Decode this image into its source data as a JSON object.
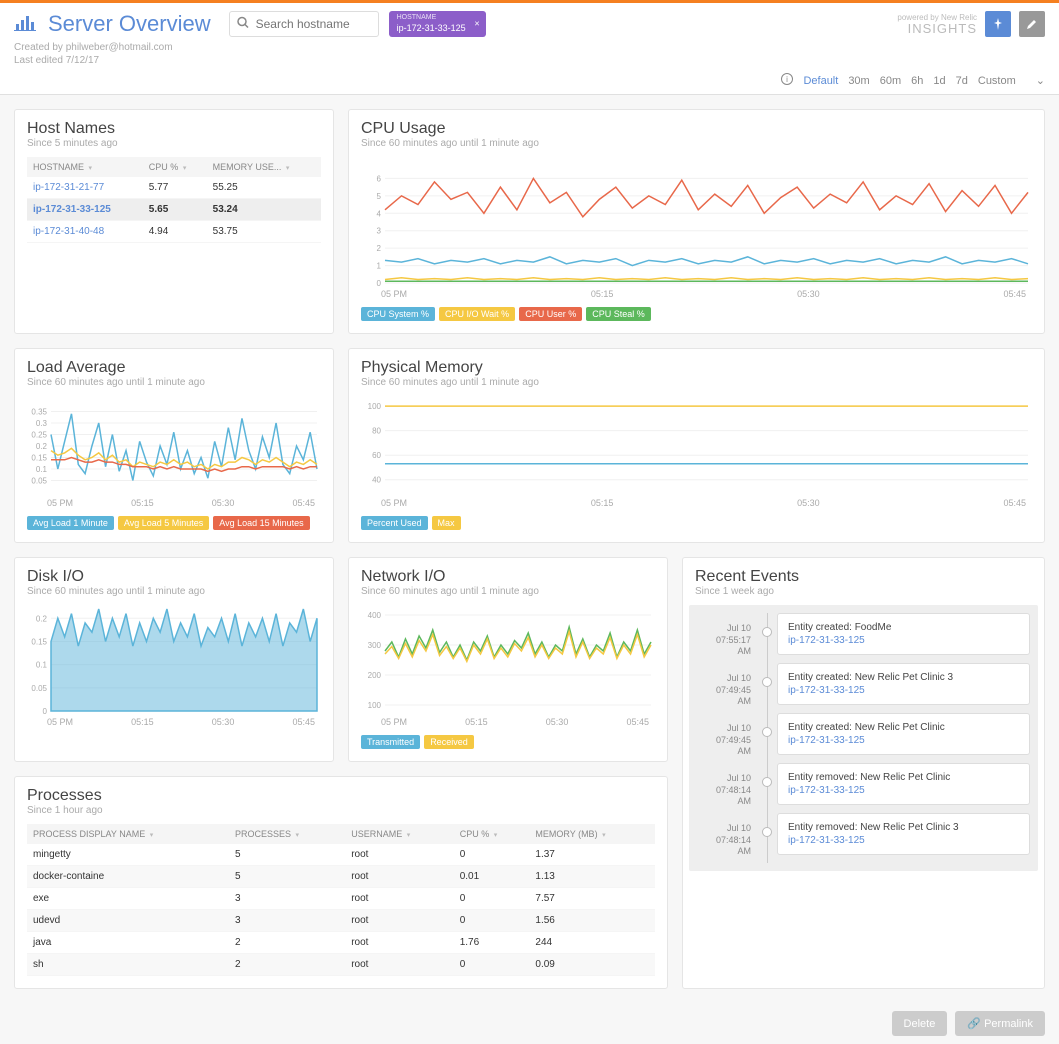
{
  "header": {
    "title": "Server Overview",
    "search_placeholder": "Search hostname",
    "active_filter_label": "HOSTNAME",
    "active_filter_value": "ip-172-31-33-125",
    "created_by": "Created by philweber@hotmail.com",
    "last_edited": "Last edited 7/12/17",
    "brand_small": "New Relic",
    "brand_big": "INSIGHTS",
    "powered": "powered by"
  },
  "time_picker": {
    "options": [
      "Default",
      "30m",
      "60m",
      "6h",
      "1d",
      "7d",
      "Custom"
    ],
    "active": "Default"
  },
  "hosts": {
    "title": "Host Names",
    "sub": "Since 5 minutes ago",
    "columns": [
      "HOSTNAME",
      "CPU %",
      "MEMORY USE..."
    ],
    "rows": [
      {
        "host": "ip-172-31-21-77",
        "cpu": "5.77",
        "mem": "55.25",
        "selected": false
      },
      {
        "host": "ip-172-31-33-125",
        "cpu": "5.65",
        "mem": "53.24",
        "selected": true
      },
      {
        "host": "ip-172-31-40-48",
        "cpu": "4.94",
        "mem": "53.75",
        "selected": false
      }
    ]
  },
  "cpu": {
    "title": "CPU Usage",
    "sub": "Since 60 minutes ago until 1 minute ago",
    "legend": [
      {
        "label": "CPU System %",
        "color": "#5bb4d9"
      },
      {
        "label": "CPU I/O Wait %",
        "color": "#f5c842"
      },
      {
        "label": "CPU User %",
        "color": "#e8684a"
      },
      {
        "label": "CPU Steal %",
        "color": "#5cb85c"
      }
    ]
  },
  "load": {
    "title": "Load Average",
    "sub": "Since 60 minutes ago until 1 minute ago",
    "legend": [
      {
        "label": "Avg Load 1 Minute",
        "color": "#5bb4d9"
      },
      {
        "label": "Avg Load 5 Minutes",
        "color": "#f5c842"
      },
      {
        "label": "Avg Load 15 Minutes",
        "color": "#e8684a"
      }
    ]
  },
  "memory": {
    "title": "Physical Memory",
    "sub": "Since 60 minutes ago until 1 minute ago",
    "legend": [
      {
        "label": "Percent Used",
        "color": "#5bb4d9"
      },
      {
        "label": "Max",
        "color": "#f5c842"
      }
    ]
  },
  "disk": {
    "title": "Disk I/O",
    "sub": "Since 60 minutes ago until 1 minute ago"
  },
  "network": {
    "title": "Network I/O",
    "sub": "Since 60 minutes ago until 1 minute ago",
    "legend": [
      {
        "label": "Transmitted",
        "color": "#5bb4d9"
      },
      {
        "label": "Received",
        "color": "#f5c842"
      }
    ]
  },
  "events": {
    "title": "Recent Events",
    "sub": "Since 1 week ago",
    "items": [
      {
        "date": "Jul 10",
        "time": "07:55:17",
        "ampm": "AM",
        "title": "Entity created: FoodMe",
        "host": "ip-172-31-33-125"
      },
      {
        "date": "Jul 10",
        "time": "07:49:45",
        "ampm": "AM",
        "title": "Entity created: New Relic Pet Clinic 3",
        "host": "ip-172-31-33-125"
      },
      {
        "date": "Jul 10",
        "time": "07:49:45",
        "ampm": "AM",
        "title": "Entity created: New Relic Pet Clinic",
        "host": "ip-172-31-33-125"
      },
      {
        "date": "Jul 10",
        "time": "07:48:14",
        "ampm": "AM",
        "title": "Entity removed: New Relic Pet Clinic",
        "host": "ip-172-31-33-125"
      },
      {
        "date": "Jul 10",
        "time": "07:48:14",
        "ampm": "AM",
        "title": "Entity removed: New Relic Pet Clinic 3",
        "host": "ip-172-31-33-125"
      }
    ]
  },
  "processes": {
    "title": "Processes",
    "sub": "Since 1 hour ago",
    "columns": [
      "PROCESS DISPLAY NAME",
      "PROCESSES",
      "USERNAME",
      "CPU %",
      "MEMORY (MB)"
    ],
    "rows": [
      {
        "name": "mingetty",
        "count": "5",
        "user": "root",
        "cpu": "0",
        "mem": "1.37"
      },
      {
        "name": "docker-containe",
        "count": "5",
        "user": "root",
        "cpu": "0.01",
        "mem": "1.13"
      },
      {
        "name": "exe",
        "count": "3",
        "user": "root",
        "cpu": "0",
        "mem": "7.57"
      },
      {
        "name": "udevd",
        "count": "3",
        "user": "root",
        "cpu": "0",
        "mem": "1.56"
      },
      {
        "name": "java",
        "count": "2",
        "user": "root",
        "cpu": "1.76",
        "mem": "244"
      },
      {
        "name": "sh",
        "count": "2",
        "user": "root",
        "cpu": "0",
        "mem": "0.09"
      }
    ]
  },
  "footer": {
    "delete": "Delete",
    "permalink": "Permalink"
  },
  "chart_data": [
    {
      "id": "cpu",
      "type": "line",
      "title": "CPU Usage",
      "x_ticks": [
        "05 PM",
        "05:15",
        "05:30",
        "05:45"
      ],
      "y_ticks": [
        0,
        1,
        2,
        3,
        4,
        5,
        6
      ],
      "ylim": [
        0,
        7
      ],
      "series": [
        {
          "name": "CPU User %",
          "color": "#e8684a",
          "values": [
            4.2,
            5.0,
            4.5,
            5.8,
            4.8,
            5.2,
            4.0,
            5.5,
            4.2,
            6.0,
            4.6,
            5.2,
            3.8,
            4.8,
            5.5,
            4.3,
            5.0,
            4.5,
            5.9,
            4.2,
            5.1,
            4.4,
            5.6,
            4.0,
            4.9,
            5.5,
            4.3,
            5.1,
            4.6,
            5.8,
            4.2,
            5.0,
            4.5,
            5.7,
            4.1,
            5.3,
            4.4,
            5.6,
            4.0,
            5.2
          ]
        },
        {
          "name": "CPU System %",
          "color": "#5bb4d9",
          "values": [
            1.3,
            1.2,
            1.4,
            1.1,
            1.3,
            1.2,
            1.4,
            1.1,
            1.3,
            1.2,
            1.5,
            1.1,
            1.3,
            1.2,
            1.4,
            1.0,
            1.3,
            1.2,
            1.4,
            1.1,
            1.3,
            1.2,
            1.5,
            1.1,
            1.3,
            1.2,
            1.4,
            1.1,
            1.3,
            1.2,
            1.4,
            1.1,
            1.3,
            1.2,
            1.5,
            1.1,
            1.3,
            1.2,
            1.4,
            1.1
          ]
        },
        {
          "name": "CPU I/O Wait %",
          "color": "#f5c842",
          "values": [
            0.2,
            0.3,
            0.2,
            0.25,
            0.2,
            0.3,
            0.2,
            0.25,
            0.2,
            0.3,
            0.2,
            0.25,
            0.2,
            0.3,
            0.2,
            0.25,
            0.2,
            0.3,
            0.2,
            0.25,
            0.2,
            0.3,
            0.2,
            0.25,
            0.2,
            0.3,
            0.2,
            0.25,
            0.2,
            0.3,
            0.2,
            0.25,
            0.2,
            0.3,
            0.2,
            0.25,
            0.2,
            0.3,
            0.2,
            0.25
          ]
        },
        {
          "name": "CPU Steal %",
          "color": "#5cb85c",
          "values": [
            0.1,
            0.1,
            0.1,
            0.1,
            0.1,
            0.1,
            0.1,
            0.1,
            0.1,
            0.1,
            0.1,
            0.1,
            0.1,
            0.1,
            0.1,
            0.1,
            0.1,
            0.1,
            0.1,
            0.1,
            0.1,
            0.1,
            0.1,
            0.1,
            0.1,
            0.1,
            0.1,
            0.1,
            0.1,
            0.1,
            0.1,
            0.1,
            0.1,
            0.1,
            0.1,
            0.1,
            0.1,
            0.1,
            0.1,
            0.1
          ]
        }
      ]
    },
    {
      "id": "load",
      "type": "line",
      "title": "Load Average",
      "x_ticks": [
        "05 PM",
        "05:15",
        "05:30",
        "05:45"
      ],
      "y_ticks": [
        0.05,
        0.1,
        0.15,
        0.2,
        0.25,
        0.3,
        0.35
      ],
      "ylim": [
        0,
        0.4
      ],
      "series": [
        {
          "name": "Avg Load 1 Minute",
          "color": "#5bb4d9",
          "values": [
            0.25,
            0.1,
            0.22,
            0.34,
            0.12,
            0.08,
            0.2,
            0.3,
            0.11,
            0.25,
            0.09,
            0.18,
            0.05,
            0.22,
            0.13,
            0.07,
            0.2,
            0.12,
            0.26,
            0.1,
            0.18,
            0.08,
            0.15,
            0.06,
            0.22,
            0.11,
            0.28,
            0.14,
            0.32,
            0.18,
            0.1,
            0.24,
            0.15,
            0.3,
            0.12,
            0.08,
            0.2,
            0.14,
            0.26,
            0.1
          ]
        },
        {
          "name": "Avg Load 5 Minutes",
          "color": "#f5c842",
          "values": [
            0.18,
            0.16,
            0.17,
            0.19,
            0.16,
            0.14,
            0.15,
            0.17,
            0.14,
            0.16,
            0.13,
            0.14,
            0.11,
            0.13,
            0.12,
            0.11,
            0.13,
            0.12,
            0.14,
            0.12,
            0.13,
            0.11,
            0.12,
            0.1,
            0.12,
            0.11,
            0.13,
            0.13,
            0.15,
            0.14,
            0.12,
            0.14,
            0.13,
            0.15,
            0.13,
            0.11,
            0.13,
            0.12,
            0.14,
            0.12
          ]
        },
        {
          "name": "Avg Load 15 Minutes",
          "color": "#e8684a",
          "values": [
            0.14,
            0.14,
            0.14,
            0.15,
            0.14,
            0.13,
            0.13,
            0.14,
            0.13,
            0.13,
            0.12,
            0.12,
            0.11,
            0.11,
            0.11,
            0.1,
            0.11,
            0.1,
            0.11,
            0.1,
            0.1,
            0.1,
            0.1,
            0.09,
            0.1,
            0.09,
            0.1,
            0.1,
            0.11,
            0.11,
            0.1,
            0.11,
            0.11,
            0.11,
            0.11,
            0.1,
            0.11,
            0.1,
            0.11,
            0.11
          ]
        }
      ]
    },
    {
      "id": "memory",
      "type": "line",
      "title": "Physical Memory",
      "x_ticks": [
        "05 PM",
        "05:15",
        "05:30",
        "05:45"
      ],
      "y_ticks": [
        40,
        60,
        80,
        100
      ],
      "ylim": [
        30,
        105
      ],
      "series": [
        {
          "name": "Max",
          "color": "#f5c842",
          "values": [
            100,
            100,
            100,
            100,
            100,
            100,
            100,
            100,
            100,
            100,
            100,
            100,
            100,
            100,
            100,
            100,
            100,
            100,
            100,
            100,
            100,
            100,
            100,
            100,
            100,
            100,
            100,
            100,
            100,
            100,
            100,
            100,
            100,
            100,
            100,
            100,
            100,
            100,
            100,
            100
          ]
        },
        {
          "name": "Percent Used",
          "color": "#5bb4d9",
          "values": [
            53,
            53,
            53,
            53,
            53,
            53,
            53,
            53,
            53,
            53,
            53,
            53,
            53,
            53,
            53,
            53,
            53,
            53,
            53,
            53,
            53,
            53,
            53,
            53,
            53,
            53,
            53,
            53,
            53,
            53,
            53,
            53,
            53,
            53,
            53,
            53,
            53,
            53,
            53,
            53
          ]
        }
      ]
    },
    {
      "id": "disk",
      "type": "area",
      "title": "Disk I/O",
      "x_ticks": [
        "05 PM",
        "05:15",
        "05:30",
        "05:45"
      ],
      "y_ticks": [
        0,
        0.05,
        0.1,
        0.15,
        0.2
      ],
      "ylim": [
        0,
        0.22
      ],
      "series": [
        {
          "name": "Disk I/O",
          "color": "#5bb4d9",
          "values": [
            0.15,
            0.2,
            0.16,
            0.21,
            0.14,
            0.19,
            0.17,
            0.22,
            0.15,
            0.2,
            0.16,
            0.21,
            0.14,
            0.19,
            0.15,
            0.2,
            0.17,
            0.22,
            0.15,
            0.19,
            0.16,
            0.21,
            0.14,
            0.18,
            0.16,
            0.2,
            0.15,
            0.21,
            0.14,
            0.19,
            0.16,
            0.2,
            0.15,
            0.21,
            0.14,
            0.19,
            0.17,
            0.22,
            0.15,
            0.2
          ]
        }
      ]
    },
    {
      "id": "network",
      "type": "line",
      "title": "Network I/O",
      "x_ticks": [
        "05 PM",
        "05:15",
        "05:30",
        "05:45"
      ],
      "y_ticks": [
        100,
        200,
        300,
        400
      ],
      "ylim": [
        80,
        420
      ],
      "series": [
        {
          "name": "Transmitted",
          "color": "#5cb85c",
          "values": [
            280,
            310,
            260,
            320,
            270,
            330,
            290,
            350,
            275,
            310,
            260,
            300,
            250,
            310,
            280,
            330,
            260,
            300,
            270,
            315,
            290,
            340,
            270,
            310,
            260,
            300,
            280,
            360,
            270,
            320,
            260,
            300,
            280,
            340,
            260,
            310,
            280,
            350,
            270,
            310
          ]
        },
        {
          "name": "Received",
          "color": "#f5c842",
          "values": [
            270,
            295,
            255,
            305,
            260,
            315,
            280,
            335,
            265,
            295,
            255,
            290,
            245,
            300,
            270,
            320,
            255,
            290,
            260,
            305,
            280,
            325,
            260,
            300,
            255,
            290,
            270,
            345,
            260,
            310,
            255,
            290,
            270,
            325,
            255,
            300,
            270,
            335,
            260,
            300
          ]
        }
      ]
    }
  ]
}
